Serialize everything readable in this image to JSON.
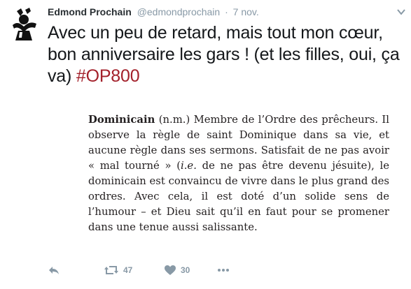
{
  "tweet": {
    "author_name": "Edmond Prochain",
    "handle": "@edmondprochain",
    "separator": "·",
    "time": "7 nov.",
    "text_main": "Avec un peu de retard, mais tout mon cœur, bon anniversaire les gars ! (et les filles, oui, ça va) ",
    "hashtag": "#OP800"
  },
  "card": {
    "term": "Dominicain",
    "definition_parts": {
      "p1": " (n.m.) Membre de l’Ordre des prêcheurs. Il observe la règle de saint Dominique dans sa vie, et aucune règle dans ses sermons. Satisfait de ne pas avoir « mal tourné » (",
      "abbrev": "i.e.",
      "p2": " de ne pas être devenu jésuite), le dominicain est convaincu de vivre dans le plus grand des ordres. Avec cela, il est doté d’un solide sens de l’humour – et Dieu sait qu’il en faut pour se promener dans une tenue aussi salissante."
    }
  },
  "actions": {
    "retweet_count": "47",
    "like_count": "30",
    "icons": [
      "reply-icon",
      "retweet-icon",
      "like-icon",
      "more-icon",
      "chevron-down-icon"
    ]
  },
  "colors": {
    "hashtag": "#a3212b",
    "muted": "#8899a6",
    "text": "#14171a"
  }
}
